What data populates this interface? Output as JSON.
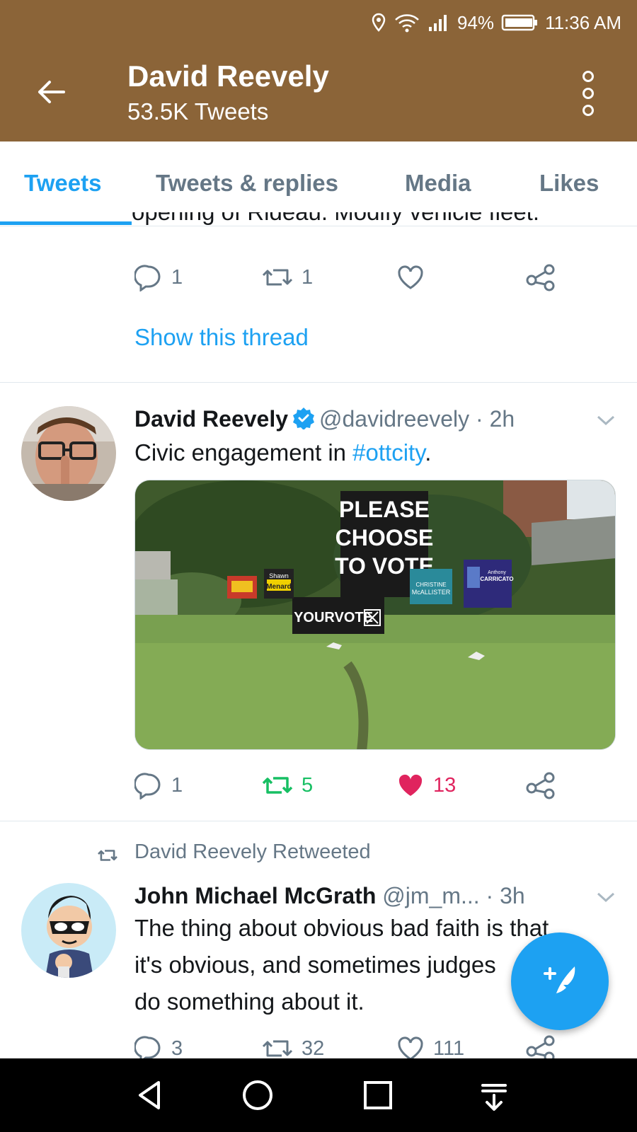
{
  "status_bar": {
    "battery": "94%",
    "time": "11:36 AM"
  },
  "header": {
    "title": "David Reevely",
    "subtitle": "53.5K Tweets"
  },
  "tabs": [
    {
      "label": "Tweets",
      "active": true
    },
    {
      "label": "Tweets & replies",
      "active": false
    },
    {
      "label": "Media",
      "active": false
    },
    {
      "label": "Likes",
      "active": false
    }
  ],
  "previous_tweet": {
    "cut_text": "opening of Rideau. Modify vehicle fleet.",
    "replies": "1",
    "retweets": "1",
    "show_thread": "Show this thread"
  },
  "tweet": {
    "name": "David Reevely",
    "handle": "@davidreevely",
    "time": "· 2h",
    "text_before": "Civic engagement in ",
    "hashtag": "#ottcity",
    "text_after": ".",
    "media": {
      "sign_main": [
        "PLEASE",
        "CHOOSE",
        "TO VOTE"
      ],
      "sign_yourvote": "YOURVOTE",
      "sign_shawn": [
        "Shawn",
        "Menard"
      ],
      "sign_carricato": [
        "Anthony",
        "CARRICATO"
      ],
      "sign_mcallister": [
        "CHRISTINE",
        "McALLISTER"
      ]
    },
    "replies": "1",
    "retweets": "5",
    "likes": "13"
  },
  "retweet": {
    "label": "David Reevely Retweeted",
    "name": "John Michael McGrath",
    "handle": "@jm_m...",
    "time": "· 3h",
    "text": [
      "The thing about obvious bad faith is that",
      "it's obvious, and sometimes judges",
      "do something about it."
    ],
    "replies": "3",
    "retweets": "32",
    "likes": "111"
  },
  "colors": {
    "header_bg": "#8b6438",
    "accent": "#1da1f2",
    "retweet_green": "#17bf63",
    "like_red": "#e0245e",
    "muted": "#657786"
  },
  "icons": [
    "back-arrow-icon",
    "more-icon",
    "reply-icon",
    "retweet-icon",
    "heart-icon",
    "share-icon",
    "verified-icon",
    "compose-icon"
  ]
}
